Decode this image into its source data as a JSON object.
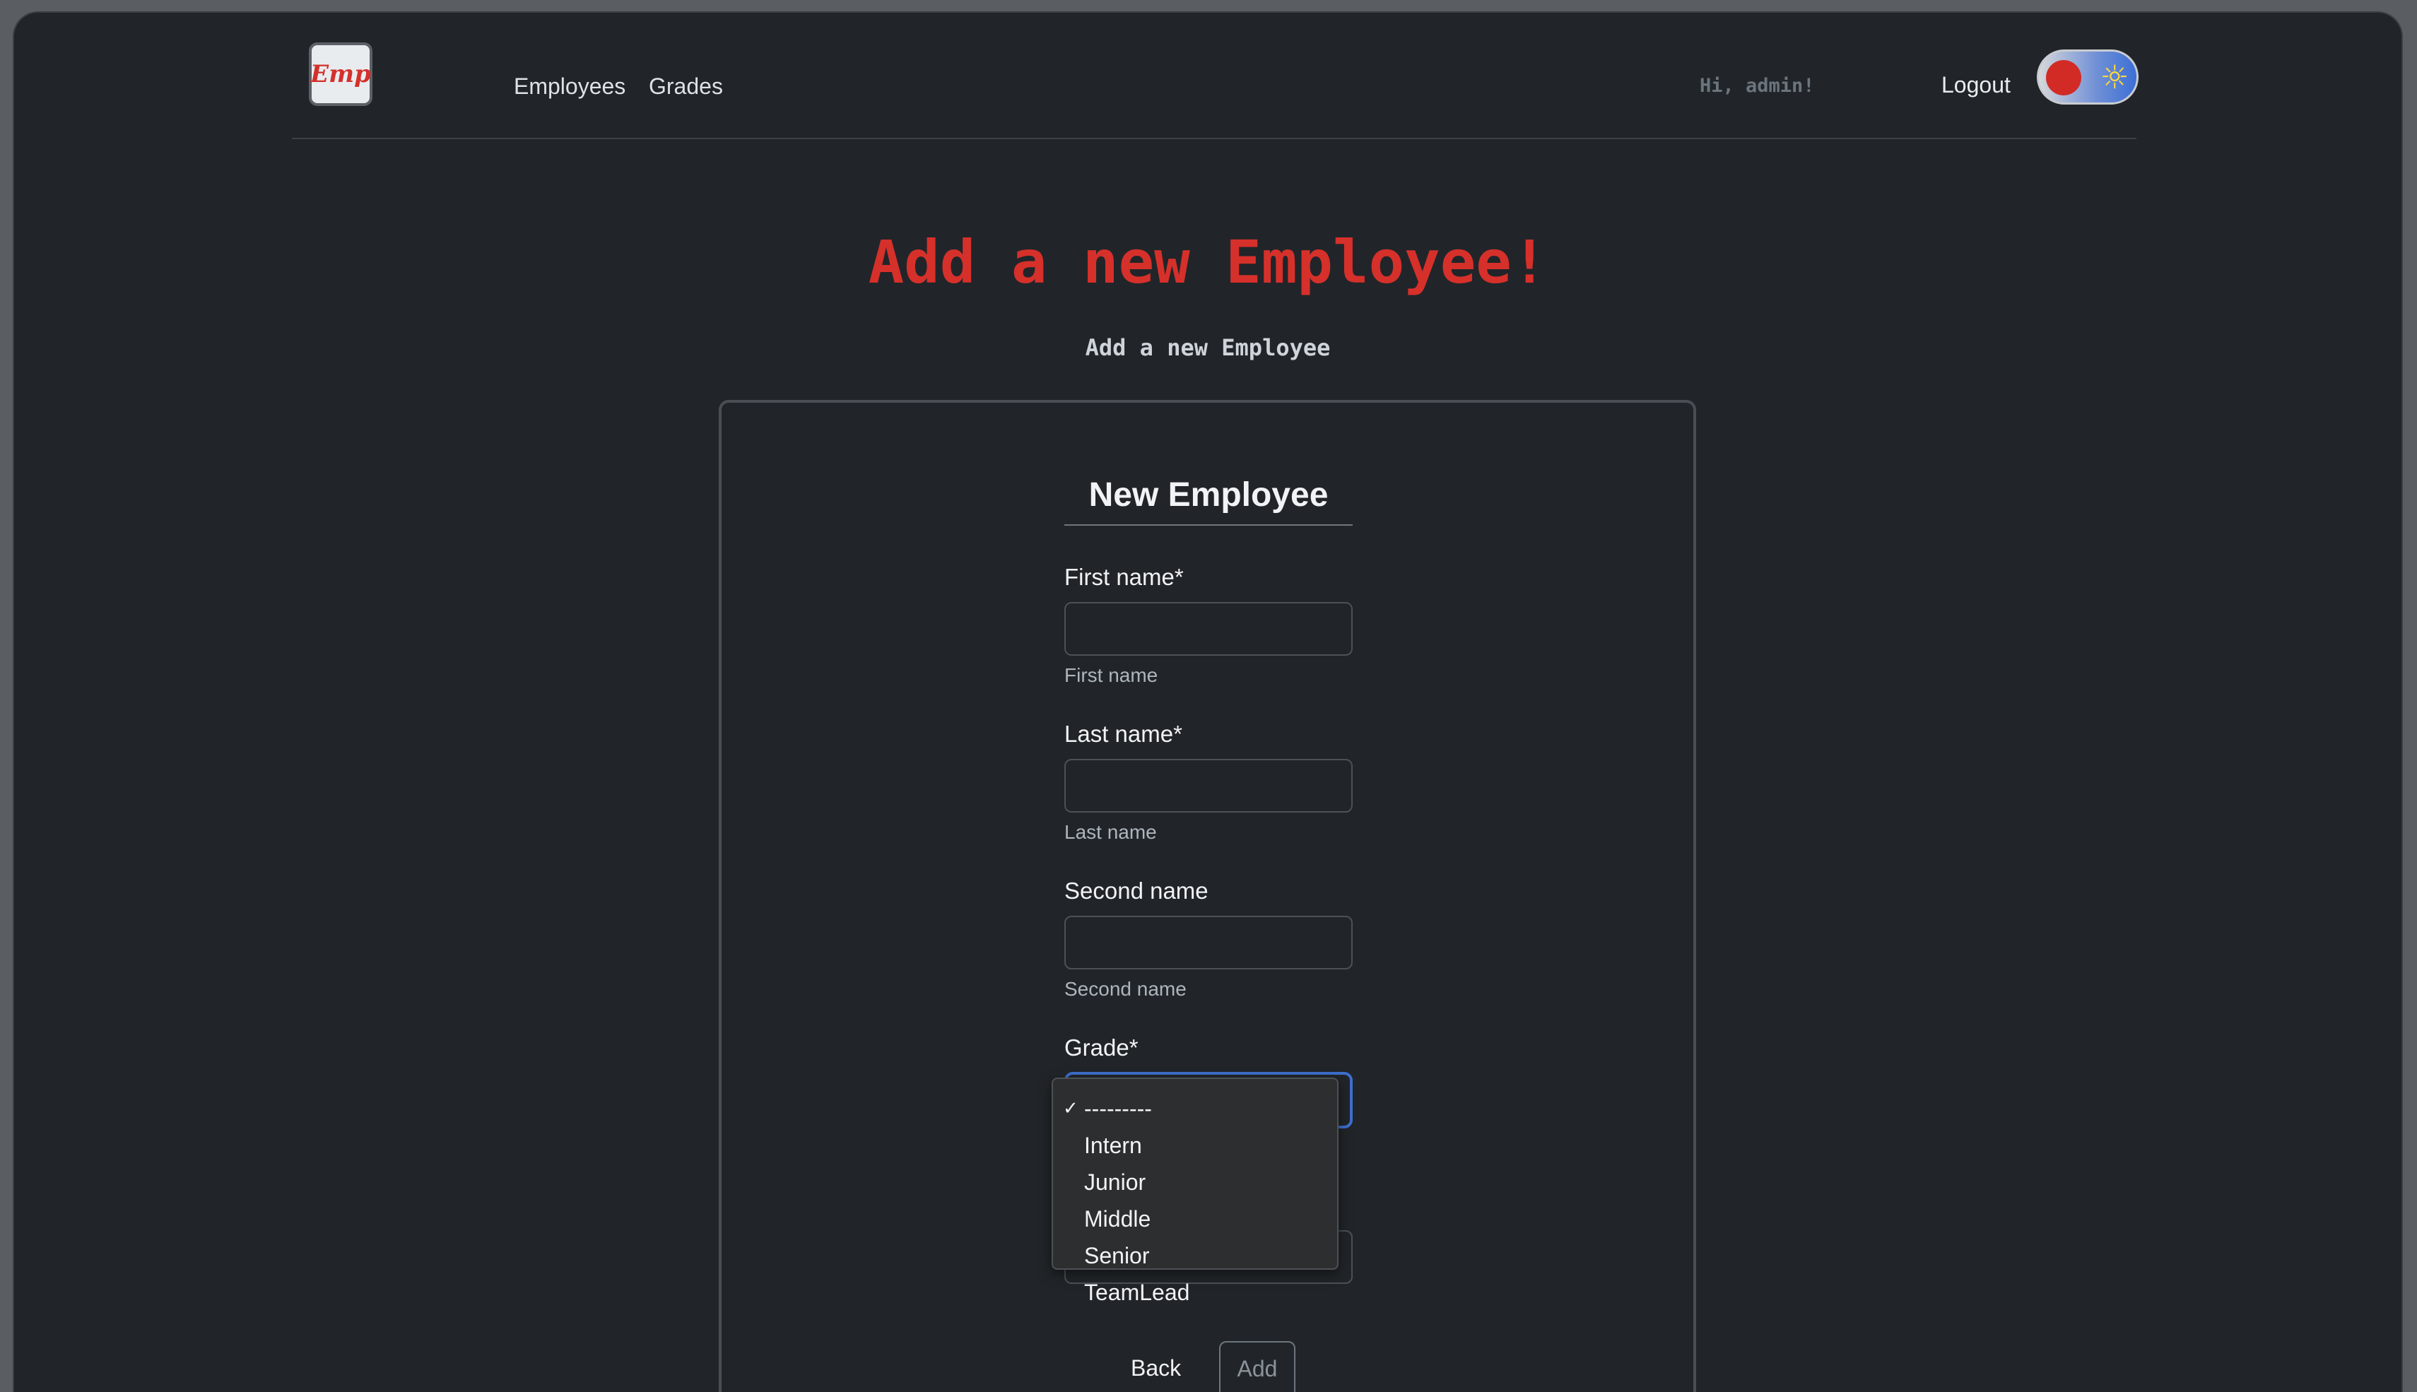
{
  "navbar": {
    "logo_text": "Emp",
    "links": [
      "Employees",
      "Grades"
    ],
    "greeting": "Hi, admin!",
    "logout_label": "Logout",
    "theme_icon": "sun-icon"
  },
  "page": {
    "title": "Add a new Employee!",
    "subtitle": "Add a new Employee"
  },
  "form": {
    "title": "New Employee",
    "first_name": {
      "label": "First name*",
      "value": "",
      "help": "First name"
    },
    "last_name": {
      "label": "Last name*",
      "value": "",
      "help": "Last name"
    },
    "second_name": {
      "label": "Second name",
      "value": "",
      "help": "Second name"
    },
    "grade": {
      "label": "Grade*",
      "selected": "---------",
      "options": [
        "---------",
        "Intern",
        "Junior",
        "Middle",
        "Senior",
        "TeamLead"
      ]
    },
    "back_label": "Back",
    "add_label": "Add"
  },
  "colors": {
    "accent_red": "#d6302b",
    "focus_blue": "#3e6fcf",
    "background": "#212529"
  }
}
